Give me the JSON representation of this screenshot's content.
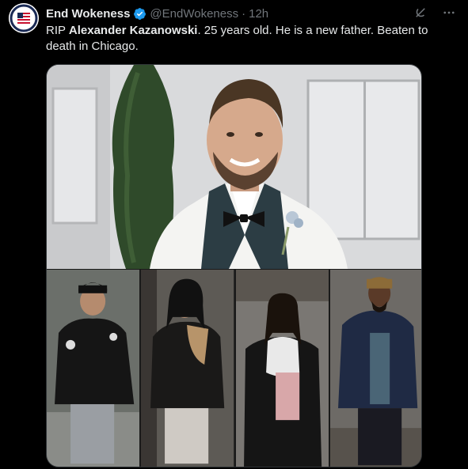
{
  "tweet": {
    "author_name": "End Wokeness",
    "author_handle": "@EndWokeness",
    "separator": "·",
    "time": "12h",
    "text_prefix": "RIP ",
    "text_bold": "Alexander Kazanowski",
    "text_suffix": ". 25 years old. He is a new father. Beaten to death in Chicago."
  },
  "icons": {
    "verified": "verified-badge-icon",
    "grok": "grok-icon",
    "more": "more-icon"
  },
  "colors": {
    "background": "#000000",
    "text": "#e7e9ea",
    "muted": "#71767b",
    "verified_blue": "#1d9bf0"
  }
}
